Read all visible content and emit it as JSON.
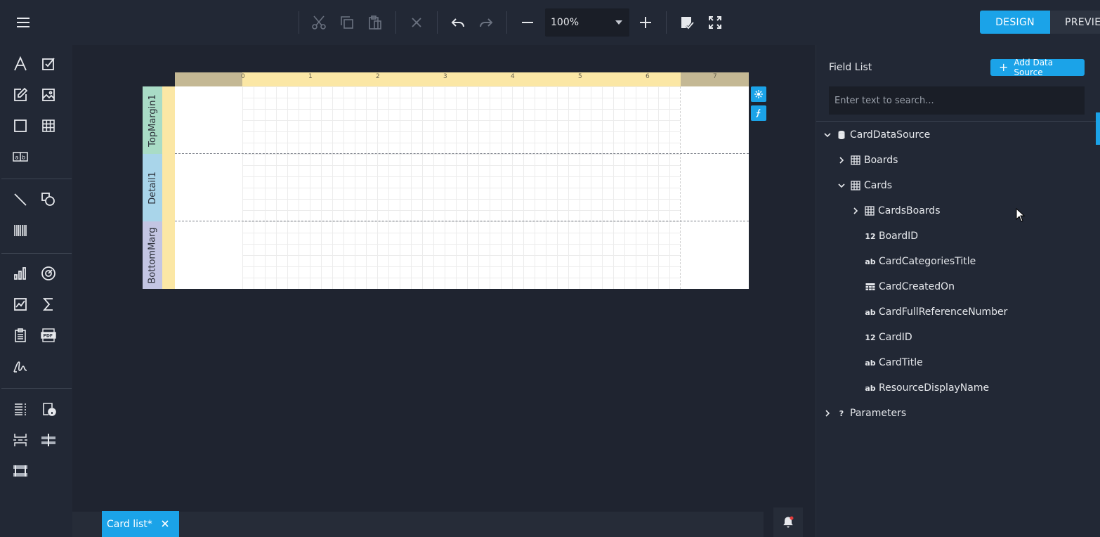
{
  "toolbar": {
    "zoom_value": "100%",
    "tab_design": "DESIGN",
    "tab_preview": "PREVIEW"
  },
  "report": {
    "ruler_numbers": [
      "0",
      "1",
      "2",
      "3",
      "4",
      "5",
      "6",
      "7"
    ],
    "bands": [
      {
        "label": "TopMargin1"
      },
      {
        "label": "Detail1"
      },
      {
        "label": "BottomMarg"
      }
    ]
  },
  "document_tab": {
    "label": "Card list*"
  },
  "field_list": {
    "title": "Field List",
    "add_data_source_label": "Add Data Source",
    "search_placeholder": "Enter text to search...",
    "tree": [
      {
        "label": "CardDataSource",
        "icon": "database-icon",
        "expanded": true
      },
      {
        "label": "Boards",
        "icon": "table-icon",
        "expanded": false
      },
      {
        "label": "Cards",
        "icon": "table-icon",
        "expanded": true
      },
      {
        "label": "CardsBoards",
        "icon": "table-icon",
        "expanded": false
      },
      {
        "label": "BoardID",
        "icon": "number-icon",
        "type_badge": "12"
      },
      {
        "label": "CardCategoriesTitle",
        "icon": "string-icon",
        "type_badge": "ab"
      },
      {
        "label": "CardCreatedOn",
        "icon": "date-icon"
      },
      {
        "label": "CardFullReferenceNumber",
        "icon": "string-icon",
        "type_badge": "ab"
      },
      {
        "label": "CardID",
        "icon": "number-icon",
        "type_badge": "12"
      },
      {
        "label": "CardTitle",
        "icon": "string-icon",
        "type_badge": "ab"
      },
      {
        "label": "ResourceDisplayName",
        "icon": "string-icon",
        "type_badge": "ab"
      },
      {
        "label": "Parameters",
        "icon": "question-icon",
        "type_badge": "?",
        "expanded": false
      }
    ]
  },
  "colors": {
    "accent": "#1ba3e8",
    "background": "#222835",
    "canvas": "#1f2430",
    "ruler": "#fbe7a5"
  }
}
